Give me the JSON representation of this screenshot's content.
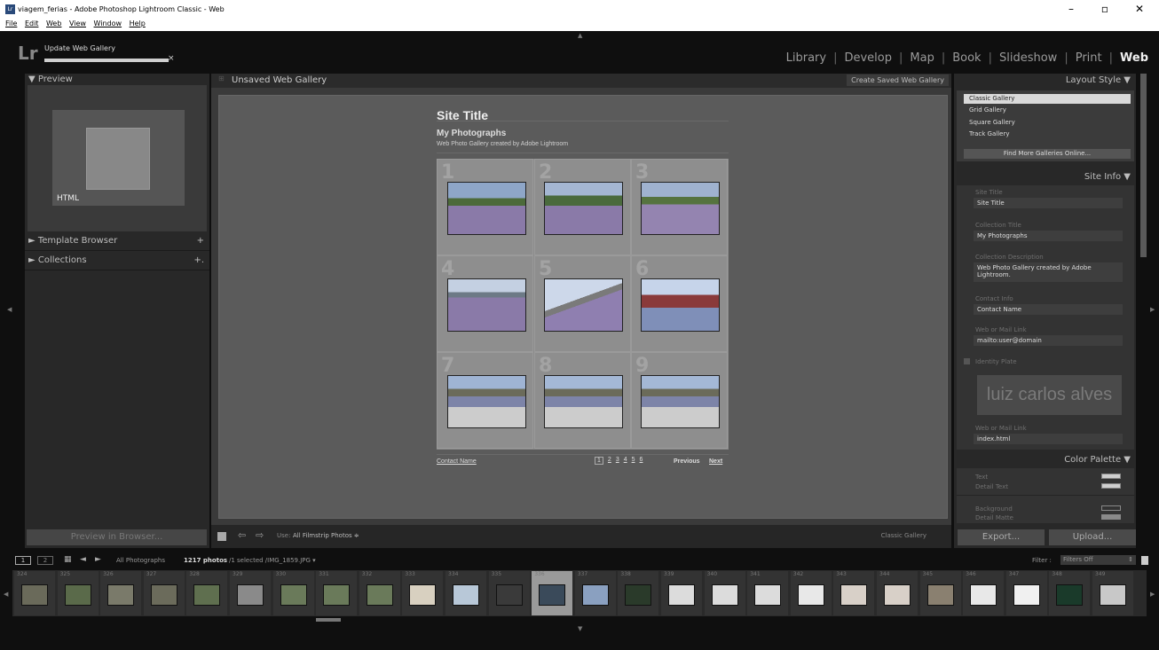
{
  "window": {
    "title": "viagem_ferias - Adobe Photoshop Lightroom Classic - Web",
    "controls": {
      "minimize": "–",
      "maximize": "▫",
      "close": "✕"
    }
  },
  "menu": [
    "File",
    "Edit",
    "Web",
    "View",
    "Window",
    "Help"
  ],
  "lr": {
    "logo": "Lr",
    "activity": "Update Web Gallery",
    "modules": [
      "Library",
      "Develop",
      "Map",
      "Book",
      "Slideshow",
      "Print",
      "Web"
    ],
    "active_module": "Web"
  },
  "left_panel": {
    "preview_header": "Preview",
    "preview_badge": "HTML",
    "template_browser": "Template Browser",
    "collections": "Collections",
    "preview_button": "Preview in Browser..."
  },
  "center": {
    "header_title": "Unsaved Web Gallery",
    "create_saved": "Create Saved Web Gallery",
    "site_title": "Site Title",
    "collection_title": "My Photographs",
    "collection_desc": "Web Photo Gallery created by Adobe Lightroom",
    "contact": "Contact Name",
    "pages": [
      "1",
      "2",
      "3",
      "4",
      "5",
      "6"
    ],
    "previous": "Previous",
    "next": "Next",
    "cell_numbers": [
      "1",
      "2",
      "3",
      "4",
      "5",
      "6",
      "7",
      "8",
      "9"
    ],
    "toolbar_use_label": "Use:",
    "toolbar_use_value": "All Filmstrip Photos",
    "toolbar_gallery": "Classic Gallery"
  },
  "right_panel": {
    "layout_style_header": "Layout Style",
    "layouts": [
      "Classic Gallery",
      "Grid Gallery",
      "Square Gallery",
      "Track Gallery"
    ],
    "find_more": "Find More Galleries Online...",
    "site_info_header": "Site Info",
    "site_title_label": "Site Title",
    "site_title_value": "Site Title",
    "collection_title_label": "Collection Title",
    "collection_title_value": "My Photographs",
    "collection_desc_label": "Collection Description",
    "collection_desc_value": "Web Photo Gallery created by Adobe Lightroom.",
    "contact_label": "Contact Info",
    "contact_value": "Contact Name",
    "weblink_label": "Web or Mail Link",
    "weblink_value": "mailto:user@domain",
    "identity_plate_label": "Identity Plate",
    "identity_plate_text": "luiz carlos alves",
    "weblink2_label": "Web or Mail Link",
    "weblink2_value": "index.html",
    "color_palette_header": "Color Palette",
    "colors": [
      {
        "label": "Text",
        "swatch": "#cfcfcf"
      },
      {
        "label": "Detail Text",
        "swatch": "#cfcfcf"
      },
      {
        "label": "Background",
        "swatch": "#333333"
      },
      {
        "label": "Detail Matte",
        "swatch": "#8a8a8a"
      }
    ],
    "export": "Export...",
    "upload": "Upload..."
  },
  "filmstrip_bar": {
    "views": [
      "1",
      "2"
    ],
    "source": "All Photographs",
    "count": "1217 photos",
    "selection": "/1 selected /IMG_1859.JPG",
    "filter_label": "Filter :",
    "filter_value": "Filters Off"
  },
  "filmstrip": {
    "numbers": [
      "324",
      "325",
      "326",
      "327",
      "328",
      "329",
      "330",
      "331",
      "332",
      "333",
      "334",
      "335",
      "336",
      "337",
      "338",
      "339",
      "340",
      "341",
      "342",
      "343",
      "344",
      "345",
      "346",
      "347",
      "348",
      "349"
    ],
    "selected_index": 12
  }
}
